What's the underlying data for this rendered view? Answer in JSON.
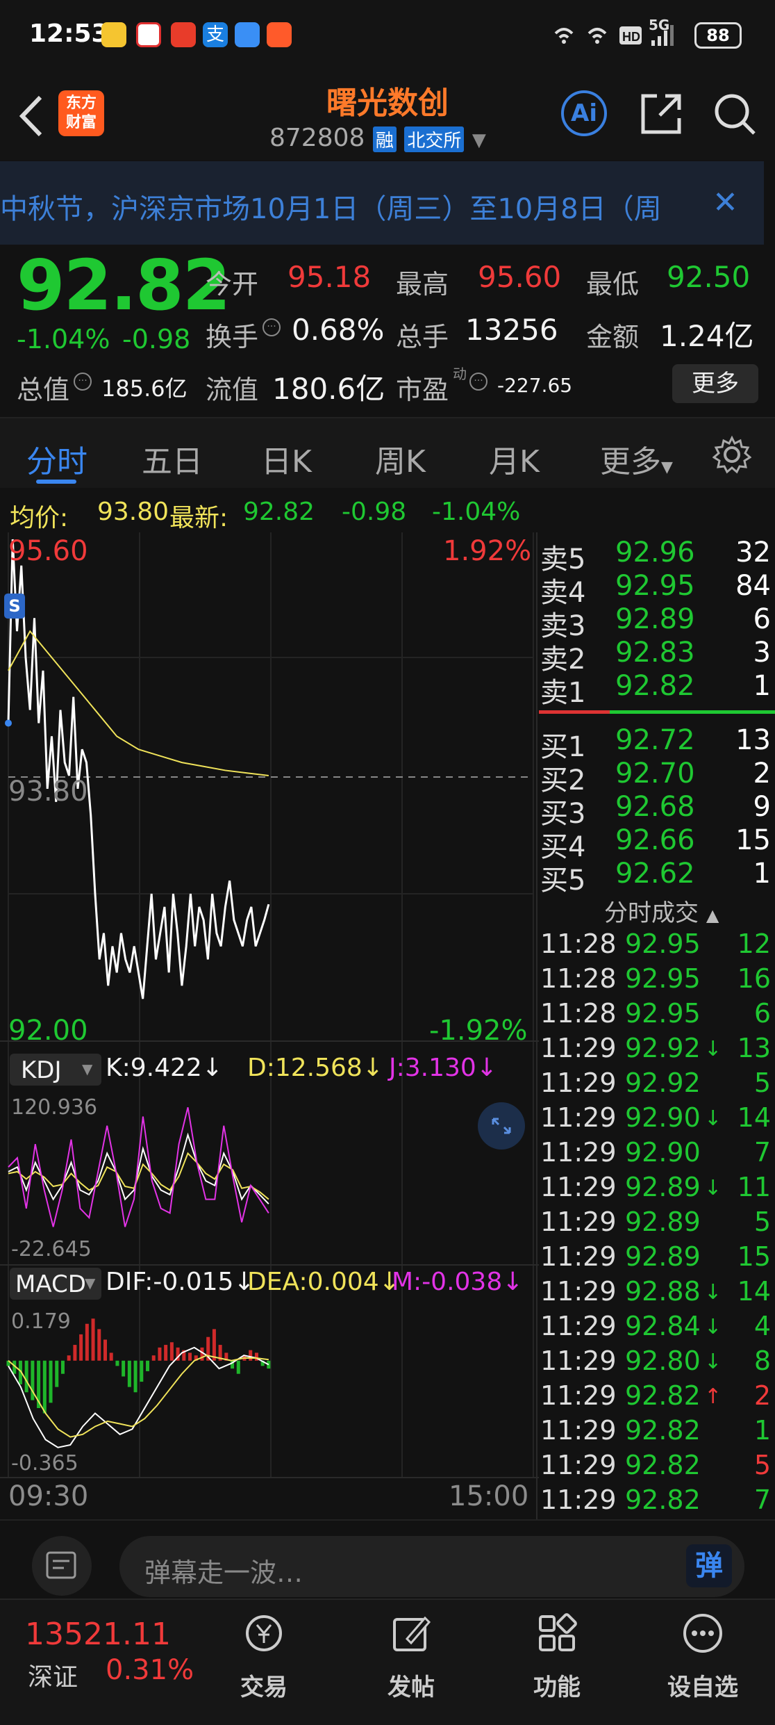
{
  "status_bar": {
    "time": "12:53",
    "battery": "88",
    "network": "5G"
  },
  "header": {
    "back_icon": "chevron-left-icon",
    "logo_text": "东方财富",
    "logo_line1": "东方",
    "logo_line2": "财富",
    "title": "曙光数创",
    "code": "872808",
    "tag_margin": "融",
    "tag_exchange": "北交所",
    "ai_label": "Ai"
  },
  "notice": {
    "text": "中秋节，沪深京市场10月1日（周三）至10月8日（周"
  },
  "quote": {
    "price": "92.82",
    "change_pct": "-1.04%",
    "change": "-0.98",
    "open_label": "今开",
    "open": "95.18",
    "high_label": "最高",
    "high": "95.60",
    "low_label": "最低",
    "low": "92.50",
    "turnover_label": "换手",
    "turnover": "0.68%",
    "volume_label": "总手",
    "volume": "13256",
    "amount_label": "金额",
    "amount": "1.24亿",
    "mktcap_label": "总值",
    "mktcap": "185.6亿",
    "float_label": "流值",
    "float_cap": "180.6亿",
    "pe_label": "市盈",
    "pe_sup": "动",
    "pe": "-227.65",
    "more_button": "更多"
  },
  "tabs": [
    {
      "label": "分时",
      "active": true
    },
    {
      "label": "五日"
    },
    {
      "label": "日K"
    },
    {
      "label": "周K"
    },
    {
      "label": "月K"
    },
    {
      "label": "更多"
    }
  ],
  "summary": {
    "avg_label": "均价:",
    "avg": "93.80",
    "last_label": "最新:",
    "last": "92.82",
    "chg": "-0.98",
    "pct": "-1.04%"
  },
  "chart_data": [
    {
      "type": "line",
      "title": "",
      "x_start": "09:30",
      "x_end": "15:00",
      "y_top": "95.60",
      "y_mid": "93.80",
      "y_bottom": "92.00",
      "pct_top": "1.92%",
      "pct_bottom": "-1.92%",
      "ylim": [
        92.0,
        95.6
      ],
      "series": [
        {
          "name": "price",
          "color": "#ffffff",
          "x": [
            0,
            2,
            4,
            6,
            8,
            10,
            12,
            14,
            16,
            18,
            20,
            22,
            24,
            26,
            28,
            30,
            32,
            34,
            36,
            38,
            40,
            42,
            44,
            46,
            48,
            50,
            52,
            54,
            56,
            58,
            60,
            62,
            64,
            66,
            68,
            70,
            72,
            74,
            76,
            78,
            80,
            82,
            84,
            86,
            88,
            90,
            92,
            94,
            96,
            98,
            100,
            102,
            104,
            106,
            108,
            110,
            112,
            114,
            116,
            118,
            120
          ],
          "values": [
            94.2,
            95.6,
            94.9,
            95.4,
            94.7,
            94.3,
            95.0,
            94.2,
            94.6,
            93.7,
            94.1,
            93.6,
            94.3,
            93.9,
            93.8,
            94.4,
            93.7,
            94.0,
            93.9,
            93.5,
            92.9,
            92.4,
            92.6,
            92.2,
            92.5,
            92.3,
            92.6,
            92.4,
            92.3,
            92.5,
            92.3,
            92.1,
            92.5,
            92.9,
            92.4,
            92.6,
            92.8,
            92.3,
            92.9,
            92.6,
            92.2,
            92.5,
            92.9,
            92.5,
            92.8,
            92.7,
            92.4,
            92.9,
            92.6,
            92.5,
            92.8,
            93.0,
            92.7,
            92.6,
            92.5,
            92.7,
            92.8,
            92.5,
            92.6,
            92.7,
            92.82
          ]
        },
        {
          "name": "avg",
          "color": "#f0e35a",
          "x": [
            0,
            10,
            20,
            30,
            40,
            50,
            60,
            70,
            80,
            90,
            100,
            110,
            120
          ],
          "values": [
            94.6,
            94.9,
            94.7,
            94.5,
            94.3,
            94.1,
            94.0,
            93.95,
            93.9,
            93.87,
            93.84,
            93.82,
            93.8
          ]
        }
      ]
    },
    {
      "type": "line",
      "title": "KDJ",
      "ylim": [
        -22.645,
        120.936
      ],
      "y_top_label": "120.936",
      "y_bottom_label": "-22.645",
      "k_label": "K:9.422",
      "d_label": "D:12.568",
      "j_label": "J:3.130",
      "series": [
        {
          "name": "K",
          "color": "#ffffff",
          "values": [
            50,
            55,
            30,
            60,
            40,
            20,
            35,
            60,
            30,
            25,
            40,
            70,
            50,
            20,
            30,
            75,
            45,
            30,
            25,
            55,
            90,
            60,
            40,
            35,
            70,
            50,
            20,
            35,
            25,
            15
          ]
        },
        {
          "name": "D",
          "color": "#f0e35a",
          "values": [
            48,
            50,
            42,
            50,
            44,
            34,
            36,
            48,
            38,
            30,
            35,
            55,
            50,
            34,
            32,
            58,
            48,
            36,
            30,
            45,
            70,
            60,
            48,
            42,
            58,
            52,
            32,
            34,
            28,
            20
          ]
        },
        {
          "name": "J",
          "color": "#e233e6",
          "values": [
            55,
            65,
            10,
            80,
            30,
            -10,
            30,
            85,
            10,
            0,
            50,
            100,
            50,
            -10,
            20,
            110,
            40,
            10,
            5,
            80,
            120,
            60,
            20,
            20,
            100,
            45,
            -5,
            35,
            20,
            5
          ]
        }
      ]
    },
    {
      "type": "bar",
      "title": "MACD",
      "ylim": [
        -0.365,
        0.179
      ],
      "y_top_label": "0.179",
      "y_bottom_label": "-0.365",
      "dif_label": "DIF:-0.015",
      "dea_label": "DEA:0.004",
      "m_label": "M:-0.038",
      "values": [
        -0.02,
        -0.05,
        -0.09,
        -0.12,
        -0.15,
        -0.18,
        -0.2,
        -0.16,
        -0.1,
        -0.05,
        0.02,
        0.06,
        0.1,
        0.14,
        0.16,
        0.12,
        0.08,
        0.03,
        -0.02,
        -0.06,
        -0.1,
        -0.12,
        -0.08,
        -0.04,
        0.02,
        0.05,
        0.06,
        0.07,
        0.05,
        0.04,
        0.03,
        0.02,
        0.05,
        0.09,
        0.12,
        0.06,
        0.03,
        -0.03,
        -0.05,
        0.02,
        0.04,
        0.03,
        -0.02,
        -0.03
      ],
      "series": [
        {
          "name": "DIF",
          "color": "#ffffff",
          "values": [
            -0.02,
            -0.1,
            -0.22,
            -0.3,
            -0.33,
            -0.32,
            -0.25,
            -0.2,
            -0.24,
            -0.28,
            -0.26,
            -0.18,
            -0.1,
            -0.02,
            0.03,
            0.05,
            0.02,
            -0.03,
            -0.01,
            0.02,
            0.01,
            -0.015
          ]
        },
        {
          "name": "DEA",
          "color": "#f0e35a",
          "values": [
            0.0,
            -0.04,
            -0.12,
            -0.2,
            -0.26,
            -0.29,
            -0.28,
            -0.25,
            -0.23,
            -0.24,
            -0.25,
            -0.22,
            -0.17,
            -0.11,
            -0.05,
            0.0,
            0.02,
            0.01,
            0.0,
            0.01,
            0.01,
            0.004
          ]
        }
      ]
    }
  ],
  "chart_ui": {
    "kdj_select": "KDJ",
    "macd_select": "MACD",
    "expand_icon": "expand-icon",
    "s_marker": "S"
  },
  "order_book": {
    "asks": [
      {
        "label": "卖5",
        "price": "92.96",
        "vol": "32"
      },
      {
        "label": "卖4",
        "price": "92.95",
        "vol": "84"
      },
      {
        "label": "卖3",
        "price": "92.89",
        "vol": "6"
      },
      {
        "label": "卖2",
        "price": "92.83",
        "vol": "3"
      },
      {
        "label": "卖1",
        "price": "92.82",
        "vol": "1"
      }
    ],
    "bids": [
      {
        "label": "买1",
        "price": "92.72",
        "vol": "13"
      },
      {
        "label": "买2",
        "price": "92.70",
        "vol": "2"
      },
      {
        "label": "买3",
        "price": "92.68",
        "vol": "9"
      },
      {
        "label": "买4",
        "price": "92.66",
        "vol": "15"
      },
      {
        "label": "买5",
        "price": "92.62",
        "vol": "1"
      }
    ]
  },
  "trades": {
    "header": "分时成交",
    "rows": [
      {
        "time": "11:28",
        "price": "92.95",
        "arrow": "",
        "vol": "12",
        "color": "green"
      },
      {
        "time": "11:28",
        "price": "92.95",
        "arrow": "",
        "vol": "16",
        "color": "green"
      },
      {
        "time": "11:28",
        "price": "92.95",
        "arrow": "",
        "vol": "6",
        "color": "green"
      },
      {
        "time": "11:29",
        "price": "92.92",
        "arrow": "↓",
        "vol": "13",
        "color": "green"
      },
      {
        "time": "11:29",
        "price": "92.92",
        "arrow": "",
        "vol": "5",
        "color": "green"
      },
      {
        "time": "11:29",
        "price": "92.90",
        "arrow": "↓",
        "vol": "14",
        "color": "green"
      },
      {
        "time": "11:29",
        "price": "92.90",
        "arrow": "",
        "vol": "7",
        "color": "green"
      },
      {
        "time": "11:29",
        "price": "92.89",
        "arrow": "↓",
        "vol": "11",
        "color": "green"
      },
      {
        "time": "11:29",
        "price": "92.89",
        "arrow": "",
        "vol": "5",
        "color": "green"
      },
      {
        "time": "11:29",
        "price": "92.89",
        "arrow": "",
        "vol": "15",
        "color": "green"
      },
      {
        "time": "11:29",
        "price": "92.88",
        "arrow": "↓",
        "vol": "14",
        "color": "green"
      },
      {
        "time": "11:29",
        "price": "92.84",
        "arrow": "↓",
        "vol": "4",
        "color": "green"
      },
      {
        "time": "11:29",
        "price": "92.80",
        "arrow": "↓",
        "vol": "8",
        "color": "green"
      },
      {
        "time": "11:29",
        "price": "92.82",
        "arrow": "↑",
        "vol": "2",
        "color": "red"
      },
      {
        "time": "11:29",
        "price": "92.82",
        "arrow": "",
        "vol": "1",
        "color": "green"
      },
      {
        "time": "11:29",
        "price": "92.82",
        "arrow": "",
        "vol": "5",
        "color": "red"
      },
      {
        "time": "11:29",
        "price": "92.82",
        "arrow": "",
        "vol": "7",
        "color": "green"
      }
    ]
  },
  "danmaku": {
    "placeholder": "弹幕走一波…",
    "toggle": "弹"
  },
  "bottom_bar": {
    "index_value": "13521.11",
    "index_name": "深证",
    "index_pct": "0.31%",
    "nav": [
      {
        "label": "交易",
        "icon": "yen-exchange-icon"
      },
      {
        "label": "发帖",
        "icon": "edit-icon"
      },
      {
        "label": "功能",
        "icon": "grid-icon"
      },
      {
        "label": "设自选",
        "icon": "more-icon"
      }
    ]
  }
}
